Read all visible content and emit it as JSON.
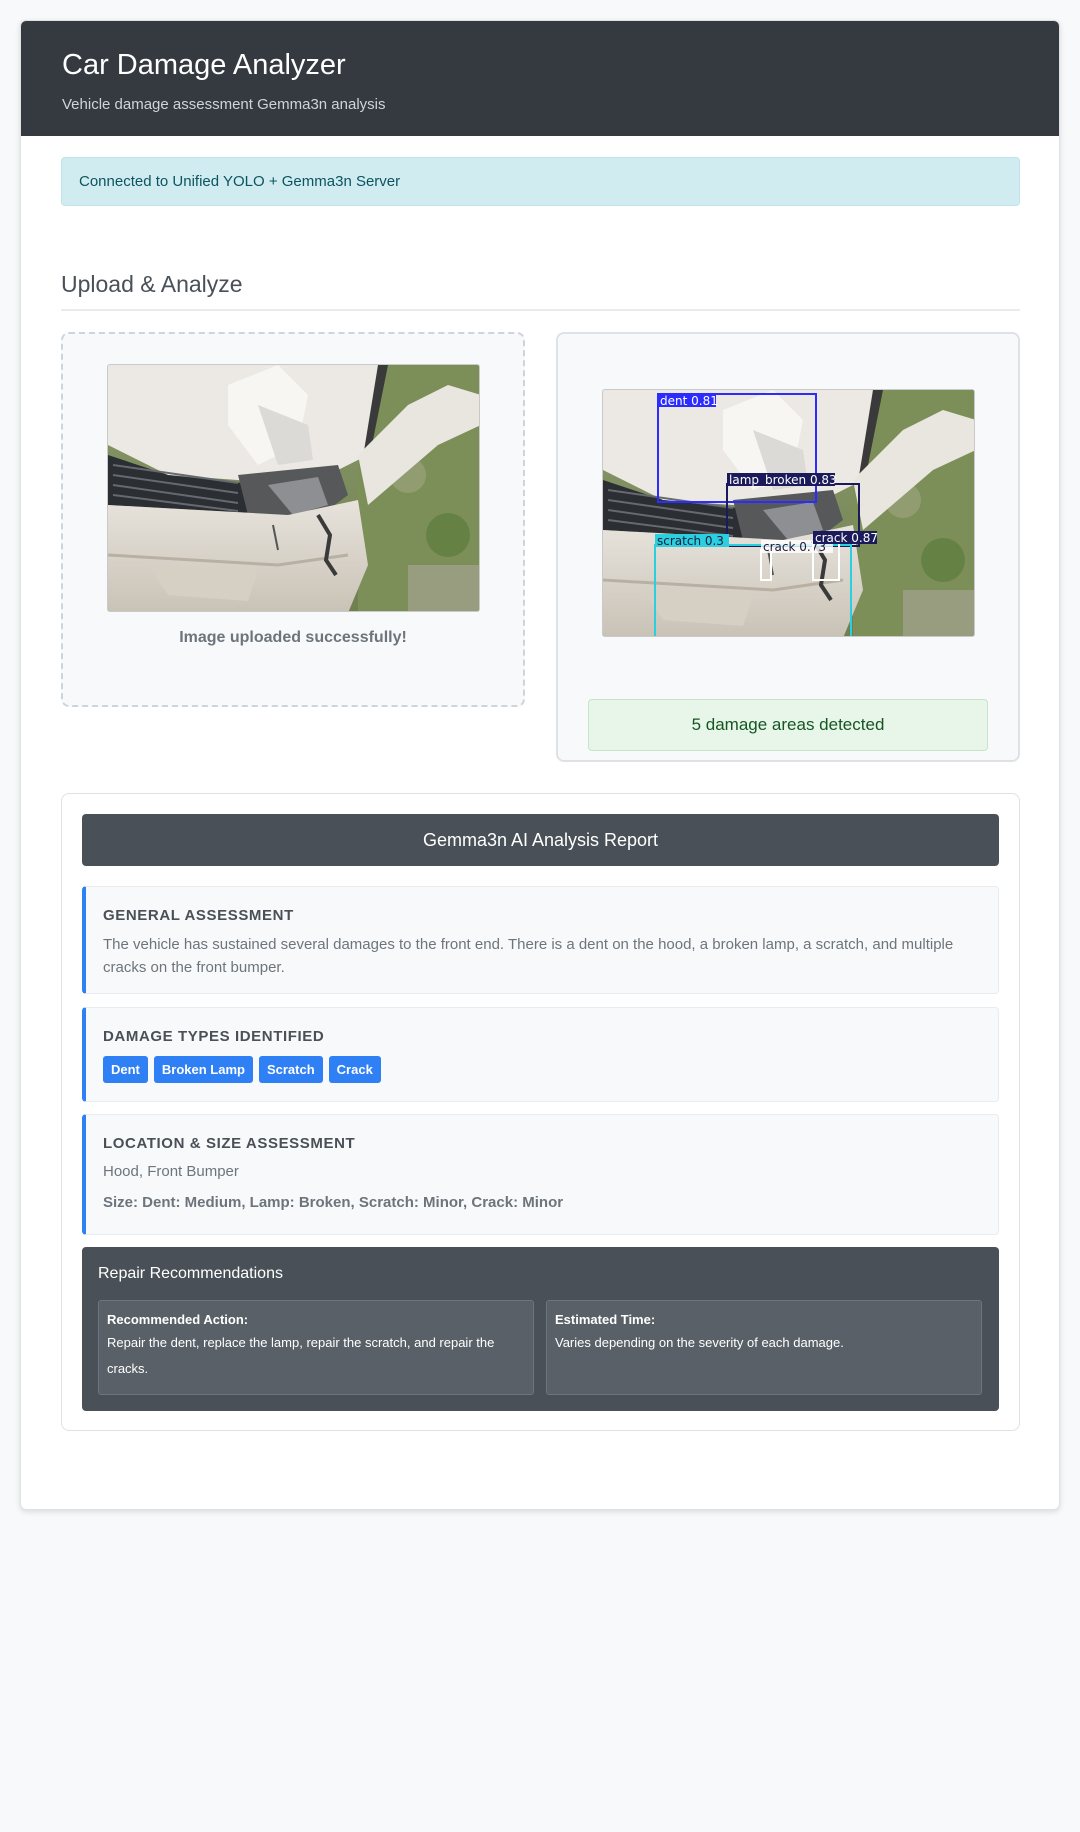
{
  "header": {
    "title": "Car Damage Analyzer",
    "subtitle": "Vehicle damage assessment Gemma3n analysis"
  },
  "connection_alert": "Connected to Unified YOLO + Gemma3n Server",
  "upload_section": {
    "title": "Upload & Analyze",
    "upload_message": "Image uploaded successfully!",
    "detection_summary": "5 damage areas detected",
    "detections": [
      {
        "label": "dent 0.81",
        "color": "#2c2cff"
      },
      {
        "label": "lamp_broken 0.83",
        "color": "#1b1b5c"
      },
      {
        "label": "scratch 0.3",
        "color": "#2ad0e0"
      },
      {
        "label": "crack 0.73",
        "color": "#ffffff"
      },
      {
        "label": "crack 0.87",
        "color": "#1b1b5c"
      }
    ]
  },
  "report": {
    "title": "Gemma3n AI Analysis Report",
    "general": {
      "heading": "GENERAL ASSESSMENT",
      "text": "The vehicle has sustained several damages to the front end. There is a dent on the hood, a broken lamp, a scratch, and multiple cracks on the front bumper."
    },
    "damage_types": {
      "heading": "DAMAGE TYPES IDENTIFIED",
      "tags": [
        "Dent",
        "Broken Lamp",
        "Scratch",
        "Crack"
      ]
    },
    "location": {
      "heading": "LOCATION & SIZE ASSESSMENT",
      "locations": "Hood, Front Bumper",
      "size": "Size: Dent: Medium, Lamp: Broken, Scratch: Minor, Crack: Minor"
    },
    "repair": {
      "heading": "Repair Recommendations",
      "action_label": "Recommended Action:",
      "action_text": "Repair the dent, replace the lamp, repair the scratch, and repair the cracks.",
      "time_label": "Estimated Time:",
      "time_text": "Varies depending on the severity of each damage."
    }
  },
  "colors": {
    "header_bg": "#343a40",
    "accent": "#2f7ff5",
    "info_bg": "#d1ecf1",
    "success_bg": "#e8f5e9",
    "report_dark": "#495057"
  }
}
